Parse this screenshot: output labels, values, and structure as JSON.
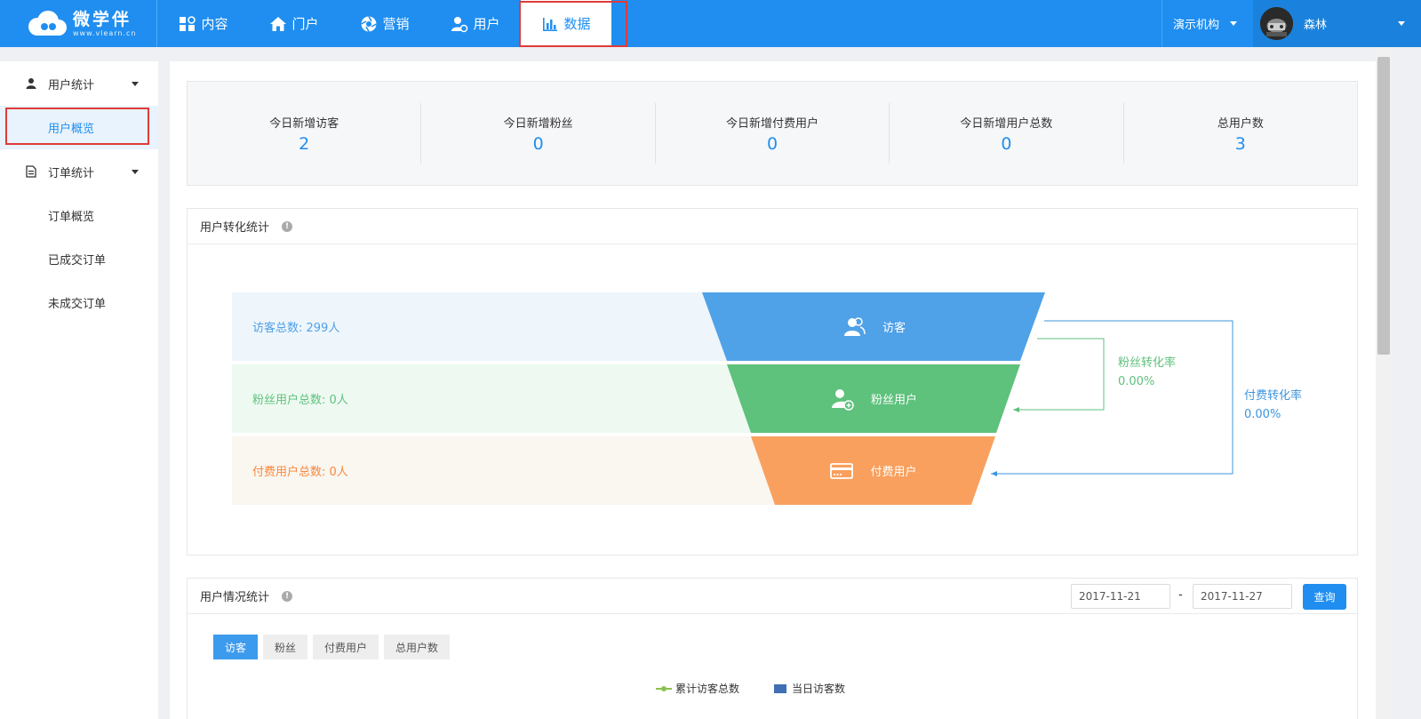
{
  "brand": {
    "name": "微学伴",
    "domain": "www.vlearn.cn"
  },
  "nav": {
    "items": [
      {
        "label": "内容",
        "icon": "grid-icon"
      },
      {
        "label": "门户",
        "icon": "home-icon"
      },
      {
        "label": "营销",
        "icon": "aperture-icon"
      },
      {
        "label": "用户",
        "icon": "user-settings-icon"
      },
      {
        "label": "数据",
        "icon": "bar-chart-icon",
        "active": true
      }
    ]
  },
  "org": {
    "label": "演示机构"
  },
  "user": {
    "name": "森林"
  },
  "sidebar": {
    "groups": [
      {
        "label": "用户统计",
        "icon": "person-icon",
        "items": [
          "用户概览"
        ]
      },
      {
        "label": "订单统计",
        "icon": "document-icon",
        "items": [
          "订单概览",
          "已成交订单",
          "未成交订单"
        ]
      }
    ],
    "active_item": "用户概览"
  },
  "stats": [
    {
      "label": "今日新增访客",
      "value": "2"
    },
    {
      "label": "今日新增粉丝",
      "value": "0"
    },
    {
      "label": "今日新增付费用户",
      "value": "0"
    },
    {
      "label": "今日新增用户总数",
      "value": "0"
    },
    {
      "label": "总用户数",
      "value": "3"
    }
  ],
  "conversion": {
    "title": "用户转化统计",
    "rows": [
      {
        "total_label": "访客总数: 299人",
        "stage": "访客",
        "icon": "users-icon",
        "color": "#4fa1e8",
        "band_color": "#eef6fb",
        "text_color": "#4fa1e8"
      },
      {
        "total_label": "粉丝用户总数: 0人",
        "stage": "粉丝用户",
        "icon": "user-add-icon",
        "color": "#5ec17c",
        "band_color": "#eefaf1",
        "text_color": "#5ec17c"
      },
      {
        "total_label": "付费用户总数: 0人",
        "stage": "付费用户",
        "icon": "credit-card-icon",
        "color": "#f9a05e",
        "band_color": "#faf6f0",
        "text_color": "#f9883e"
      }
    ],
    "fan_rate": {
      "label": "粉丝转化率",
      "value": "0.00%",
      "color": "#5ec17c"
    },
    "paid_rate": {
      "label": "付费转化率",
      "value": "0.00%",
      "color": "#3c95de"
    }
  },
  "user_stats": {
    "title": "用户情况统计",
    "start_date": "2017-11-21",
    "separator": "-",
    "end_date": "2017-11-27",
    "query_label": "查询",
    "tabs": [
      "访客",
      "粉丝",
      "付费用户",
      "总用户数"
    ],
    "legend": [
      "累计访客总数",
      "当日访客数"
    ]
  }
}
